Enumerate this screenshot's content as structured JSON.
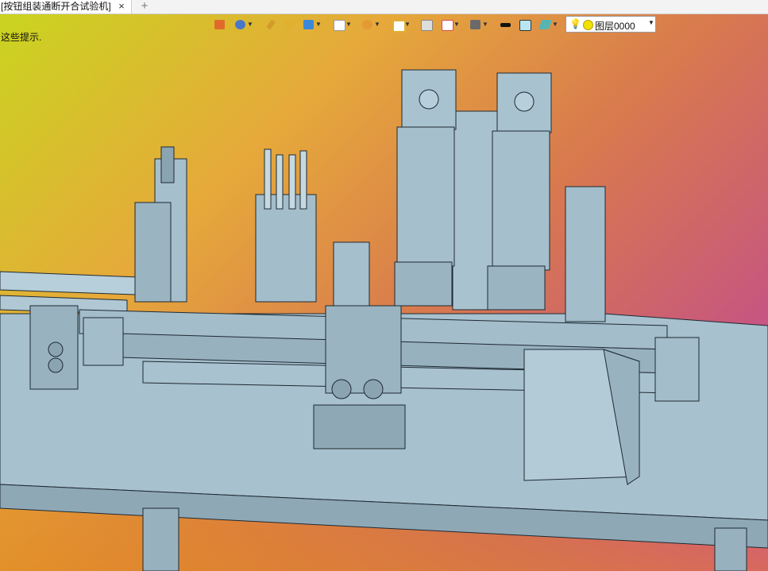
{
  "tab": {
    "title": "[按钮组装通断开合试验机]",
    "close_icon": "×",
    "add_icon": "+"
  },
  "hint": "这些提示.",
  "toolbar": {
    "icons": [
      {
        "name": "exit-icon",
        "color": "#e06a2a"
      },
      {
        "name": "view-orient-icon",
        "color": "#4a78c9"
      },
      {
        "name": "pen-icon",
        "color": "#d49b2a"
      },
      {
        "name": "shade-icon",
        "color": "#e0b030"
      },
      {
        "name": "solid-icon",
        "color": "#3c88d8"
      },
      {
        "name": "cube-icon",
        "color": "#bfbfbf"
      },
      {
        "name": "render-icon",
        "color": "#e39a33"
      },
      {
        "name": "zoom-fit-icon",
        "color": "#e0b030"
      },
      {
        "name": "section-icon",
        "color": "#888888"
      },
      {
        "name": "split-icon",
        "color": "#d84a4a"
      },
      {
        "name": "display-icon",
        "color": "#6a6a6a"
      },
      {
        "name": "line-color-icon",
        "color": "#111111"
      },
      {
        "name": "fill-color-icon",
        "color": "#b9e6f2"
      },
      {
        "name": "material-icon",
        "color": "#57b5b1"
      }
    ]
  },
  "layer": {
    "bulb_icon": "bulb-icon",
    "name": "图层0000"
  },
  "colors": {
    "steel": "#9eb8c6",
    "edge": "#1d2a33",
    "frame": "#a5bfcc"
  }
}
